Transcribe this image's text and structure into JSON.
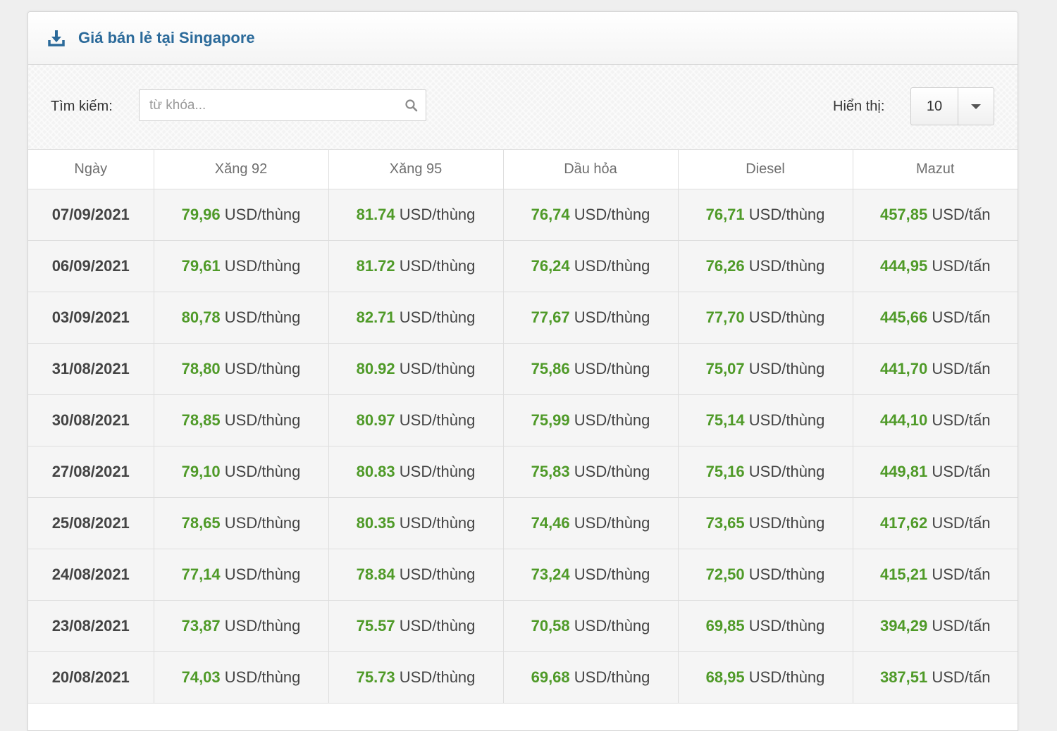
{
  "panel": {
    "title": "Giá bán lẻ tại Singapore",
    "title_icon": "download-icon",
    "accent_color": "#2b6a9a"
  },
  "toolbar": {
    "search_label": "Tìm kiếm:",
    "search_placeholder": "từ khóa...",
    "search_icon": "search-icon",
    "show_label": "Hiển thị:",
    "show_value": "10",
    "show_icon": "caret-down-icon"
  },
  "table": {
    "value_color": "#4f9a28",
    "headers": [
      "Ngày",
      "Xăng 92",
      "Xăng 95",
      "Dầu hỏa",
      "Diesel",
      "Mazut"
    ],
    "units": {
      "barrel": "USD/thùng",
      "ton": "USD/tấn"
    },
    "rows": [
      {
        "date": "07/09/2021",
        "x92": "79,96",
        "x95": "81.74",
        "dh": "76,74",
        "ds": "76,71",
        "mz": "457,85"
      },
      {
        "date": "06/09/2021",
        "x92": "79,61",
        "x95": "81.72",
        "dh": "76,24",
        "ds": "76,26",
        "mz": "444,95"
      },
      {
        "date": "03/09/2021",
        "x92": "80,78",
        "x95": "82.71",
        "dh": "77,67",
        "ds": "77,70",
        "mz": "445,66"
      },
      {
        "date": "31/08/2021",
        "x92": "78,80",
        "x95": "80.92",
        "dh": "75,86",
        "ds": "75,07",
        "mz": "441,70"
      },
      {
        "date": "30/08/2021",
        "x92": "78,85",
        "x95": "80.97",
        "dh": "75,99",
        "ds": "75,14",
        "mz": "444,10"
      },
      {
        "date": "27/08/2021",
        "x92": "79,10",
        "x95": "80.83",
        "dh": "75,83",
        "ds": "75,16",
        "mz": "449,81"
      },
      {
        "date": "25/08/2021",
        "x92": "78,65",
        "x95": "80.35",
        "dh": "74,46",
        "ds": "73,65",
        "mz": "417,62"
      },
      {
        "date": "24/08/2021",
        "x92": "77,14",
        "x95": "78.84",
        "dh": "73,24",
        "ds": "72,50",
        "mz": "415,21"
      },
      {
        "date": "23/08/2021",
        "x92": "73,87",
        "x95": "75.57",
        "dh": "70,58",
        "ds": "69,85",
        "mz": "394,29"
      },
      {
        "date": "20/08/2021",
        "x92": "74,03",
        "x95": "75.73",
        "dh": "69,68",
        "ds": "68,95",
        "mz": "387,51"
      }
    ]
  }
}
